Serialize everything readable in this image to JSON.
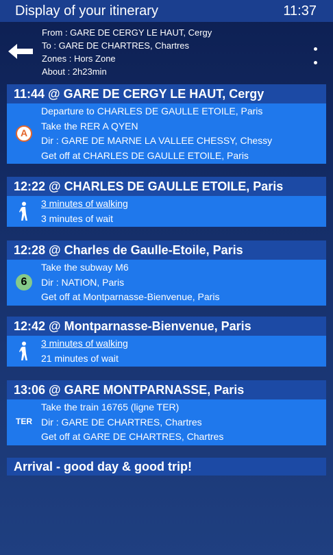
{
  "topbar": {
    "title": "Display of your itinerary",
    "time": "11:37"
  },
  "summary": {
    "from": "From : GARE DE CERGY LE HAUT, Cergy",
    "to": "To : GARE DE CHARTRES, Chartres",
    "zones": "Zones : Hors Zone",
    "about": "About : 2h23min"
  },
  "steps": [
    {
      "header": "11:44 @ GARE DE CERGY LE HAUT, Cergy",
      "icon": "A",
      "lines": [
        "Departure to CHARLES DE GAULLE ETOILE, Paris",
        "Take the RER A QYEN",
        "Dir : GARE DE MARNE LA VALLEE CHESSY, Chessy",
        "Get off at CHARLES DE GAULLE ETOILE, Paris"
      ]
    },
    {
      "header": "12:22 @ CHARLES DE GAULLE ETOILE, Paris",
      "icon": "walking-icon",
      "lines": [
        "3 minutes of walking",
        "3 minutes of wait"
      ]
    },
    {
      "header": "12:28 @ Charles de Gaulle-Etoile, Paris",
      "icon": "6",
      "lines": [
        "Take the subway M6",
        "Dir : NATION, Paris",
        "Get off at Montparnasse-Bienvenue, Paris"
      ]
    },
    {
      "header": "12:42 @ Montparnasse-Bienvenue, Paris",
      "icon": "walking-icon",
      "lines": [
        "3 minutes of walking",
        "21 minutes of wait"
      ]
    },
    {
      "header": "13:06 @ GARE MONTPARNASSE, Paris",
      "icon": "TER",
      "lines": [
        "Take the train 16765 (ligne TER)",
        "Dir : GARE DE CHARTRES, Chartres",
        "Get off at GARE DE CHARTRES, Chartres"
      ]
    }
  ],
  "arrival": "Arrival - good day & good trip!",
  "colors": {
    "header_bar": "#1c4aa5",
    "body_bar": "#1f78ec",
    "rer_a": "#e3652b",
    "metro_6": "#86c98a"
  }
}
